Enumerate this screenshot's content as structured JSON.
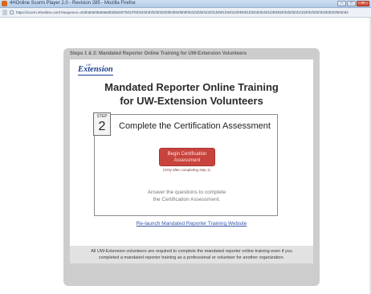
{
  "window": {
    "title": "4HOnline Scorm Player 2.0 - Revision 285 - Mozilla Firefox",
    "controls": {
      "minimize": "–",
      "maximize": "□",
      "close": "✕"
    }
  },
  "address_bar": {
    "url": "https://scorm.4honline.com/?sequence=403f4836f3689680fd3b5f4f7f5f1f7f0f4f4f4f3f3f2f3f3f2f2f0f4f6f4f9f3f0f2f1f2f3f4f1f2f2f1f2f0f1f3f4f1f2f0f0f3f1f3f2f4f3f2f4f1f2f5f3f2f0f3f2f3f2f1f1f2f0f2f3f2f3f2f3f3f2f3f0f4f4f4"
  },
  "panel": {
    "header": "Steps 1 & 2: Mandated Reporter Online Training for UW-Extension Volunteers"
  },
  "logo": {
    "top_text": "UW",
    "main_text": "Extension"
  },
  "main": {
    "title_line1": "Mandated Reporter Online Training",
    "title_line2": "for UW-Extension Volunteers"
  },
  "step": {
    "label": "STEP",
    "number": "2",
    "title": "Complete the Certification Assessment",
    "button_line1": "Begin Certification",
    "button_line2": "Assessment",
    "note": "(Only after completing step 1)",
    "answer_line1": "Answer the questions to complete",
    "answer_line2": "the Certification Assessment."
  },
  "relaunch": {
    "label": "Re-launch Mandated Reporter Training Website"
  },
  "notice": {
    "line1": "All UW-Extension volunteers are required to complete the mandated reporter online training even if you",
    "line2": "completed a mandated reporter training as a professional or volunteer for another organization."
  },
  "colors": {
    "accent_button": "#c9433d",
    "link": "#3554a8",
    "panel_bg": "#cdcdcd",
    "logo_blue": "#1a3f8f"
  }
}
